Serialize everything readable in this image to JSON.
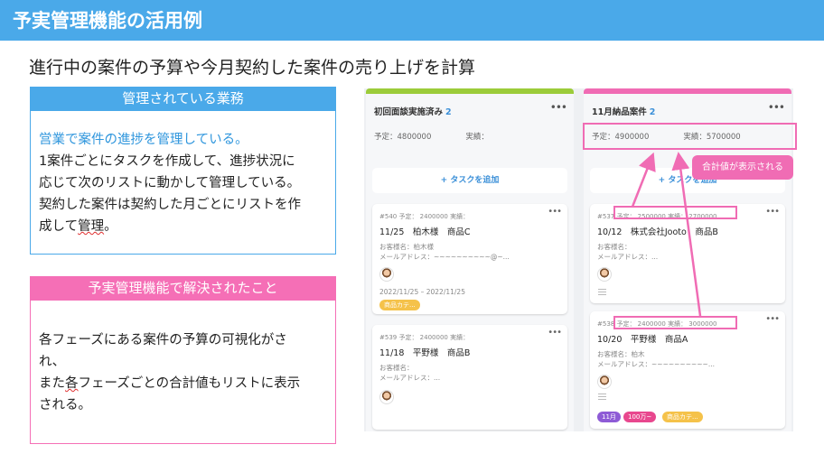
{
  "page": {
    "title": "予実管理機能の活用例",
    "subtitle": "進行中の案件の予算や今月契約した案件の売り上げを計算"
  },
  "box1": {
    "heading": "管理されている業務",
    "line1": "営業で案件の進捗を管理している。",
    "line2": "1案件ごとにタスクを作成して、進捗状況に",
    "line3": "応じて次のリストに動かして管理している。",
    "line4": "契約した案件は契約した月ごとにリストを作",
    "line5a": "成して",
    "line5b": "管理",
    "line5c": "。"
  },
  "box2": {
    "heading": "予実管理機能で解決されたこと",
    "line1": "各フェーズにある案件の予算の可視化がさ",
    "line2": "れ、",
    "line3a": "また",
    "line3b": "各",
    "line3c": "フェーズごとの合計値もリストに表示",
    "line4": "される。"
  },
  "board": {
    "add_task_label": "+  タスクを追加",
    "col1": {
      "title": "初回面談実施済み",
      "count": "2",
      "sum_plan": "予定：4800000",
      "sum_actual": "実績：",
      "cards": [
        {
          "meta": "#540  予定： 2400000  実績：",
          "title": "11/25　柏木様　商品C",
          "customer": "お客様名：柏木様",
          "email": "メールアドレス：~~~~~~~~~~@~...",
          "date": "2022/11/25 – 2022/11/25",
          "tag": "商品カテ..."
        },
        {
          "meta": "#539  予定： 2400000  実績：",
          "title": "11/18　平野様　商品B",
          "customer": "お客様名：",
          "email": "メールアドレス：..."
        }
      ]
    },
    "col2": {
      "title": "11月納品案件",
      "count": "2",
      "sum_plan": "予定：4900000",
      "sum_actual": "実績：5700000",
      "cards": [
        {
          "meta": "#537  予定： 2500000  実績： 2700000",
          "title": "10/12　株式会社Jooto　商品B",
          "customer": "お客様名：",
          "email": "メールアドレス：..."
        },
        {
          "meta": "#538  予定： 2400000  実績： 3000000",
          "title": "10/20　平野様　商品A",
          "customer": "お客様名：柏木",
          "email": "メールアドレス：~~~~~~~~~~...",
          "tags": [
            "11月",
            "100万~",
            "商品カテ..."
          ]
        }
      ]
    },
    "callout": "合計値が表示される"
  },
  "colors": {
    "blue": "#4aa9e9",
    "pink": "#f06cb4",
    "green": "#9ccc3a",
    "tag_yellow": "#f5c24a",
    "tag_purple": "#8e5bd6",
    "tag_pink": "#e8478e"
  },
  "icons": [
    "more-icon",
    "plus-icon",
    "avatar-icon",
    "list-icon",
    "arrow-icon"
  ]
}
